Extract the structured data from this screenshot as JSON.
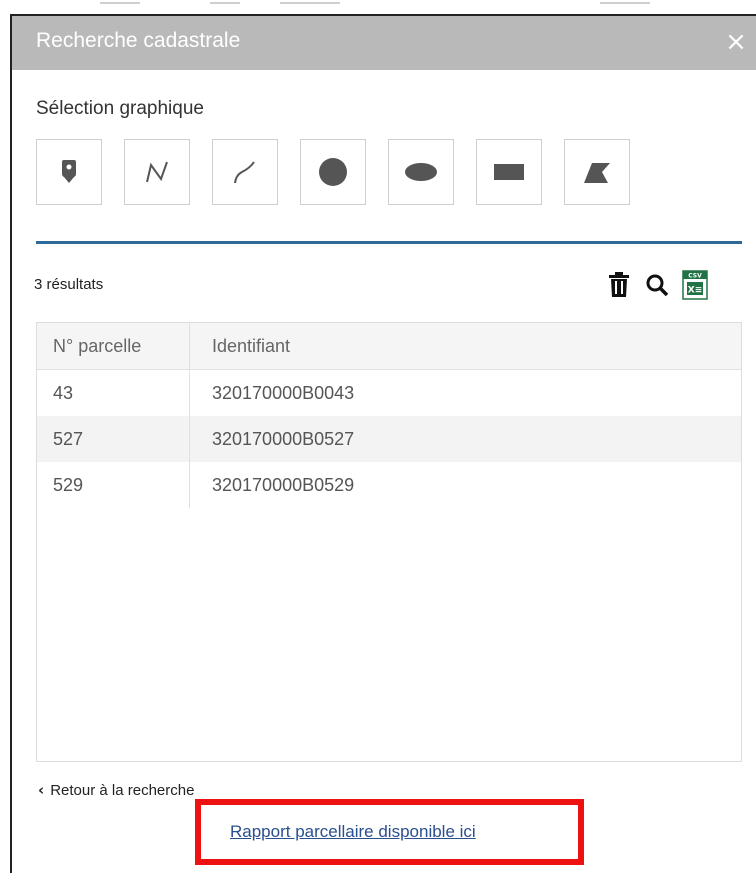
{
  "window": {
    "title": "Recherche cadastrale",
    "close_label": "×"
  },
  "selection": {
    "label": "Sélection graphique",
    "tools": [
      {
        "icon": "point-marker-icon"
      },
      {
        "icon": "polyline-icon"
      },
      {
        "icon": "freehand-line-icon"
      },
      {
        "icon": "circle-icon"
      },
      {
        "icon": "ellipse-icon"
      },
      {
        "icon": "rectangle-icon"
      },
      {
        "icon": "freehand-polygon-icon"
      }
    ]
  },
  "results": {
    "count_label": "3 résultats",
    "actions": [
      {
        "icon": "trash-icon"
      },
      {
        "icon": "search-icon"
      },
      {
        "icon": "csv-export-icon",
        "badge": "CSV",
        "text": "X≡"
      }
    ]
  },
  "table": {
    "columns": [
      "N° parcelle",
      "Identifiant"
    ],
    "rows": [
      [
        "43",
        "320170000B0043"
      ],
      [
        "527",
        "320170000B0527"
      ],
      [
        "529",
        "320170000B0529"
      ]
    ]
  },
  "footer": {
    "back_label": "Retour à la recherche",
    "report_link": "Rapport parcellaire disponible ici"
  },
  "colors": {
    "header_bg": "#b9b9b9",
    "divider": "#2d6a9a",
    "link": "#2a4f8f",
    "highlight_box": "#ee1111",
    "excel_green": "#217346"
  }
}
